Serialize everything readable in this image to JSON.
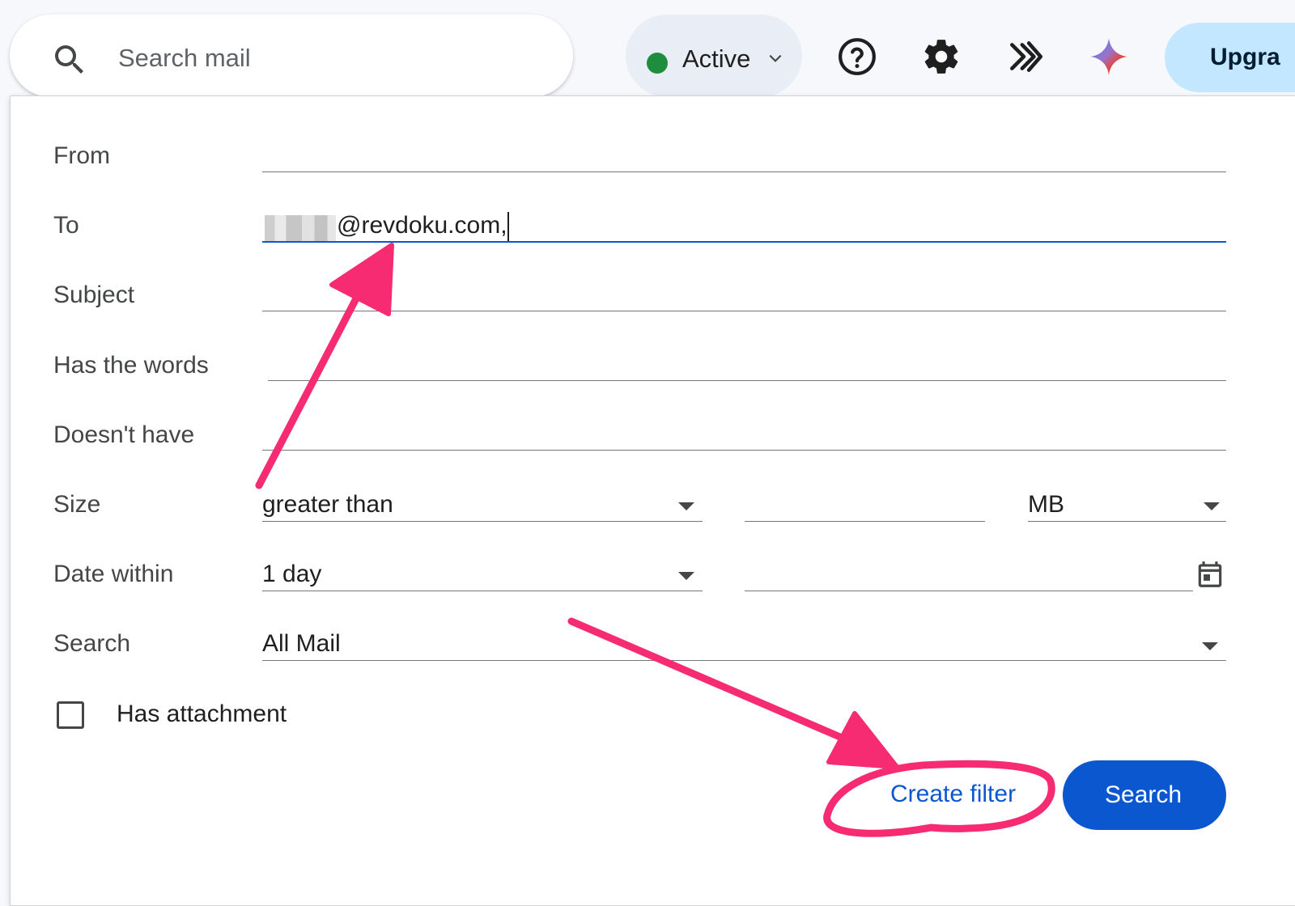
{
  "header": {
    "search_placeholder": "Search mail",
    "status": {
      "label": "Active",
      "color": "#1e8e3e"
    },
    "icons": [
      "help-icon",
      "settings-icon",
      "gemini-apps-icon",
      "gemini-icon"
    ],
    "upgrade_label": "Upgra"
  },
  "filter": {
    "labels": {
      "from": "From",
      "to": "To",
      "subject": "Subject",
      "has_words": "Has the words",
      "doesnt_have": "Doesn't have",
      "size": "Size",
      "date_within": "Date within",
      "search": "Search",
      "has_attachment": "Has attachment"
    },
    "values": {
      "from": "",
      "to": "@revdoku.com,",
      "subject": "",
      "has_words": "",
      "doesnt_have": "",
      "size_operator": "greater than",
      "size_value": "",
      "size_unit": "MB",
      "date_within": "1 day",
      "date": "",
      "search_scope": "All Mail",
      "has_attachment": false
    },
    "create_filter_label": "Create filter",
    "search_button_label": "Search"
  },
  "colors": {
    "accent": "#0b57d0",
    "annotation": "#f72b72",
    "focused_underline": "#0b57d0"
  }
}
